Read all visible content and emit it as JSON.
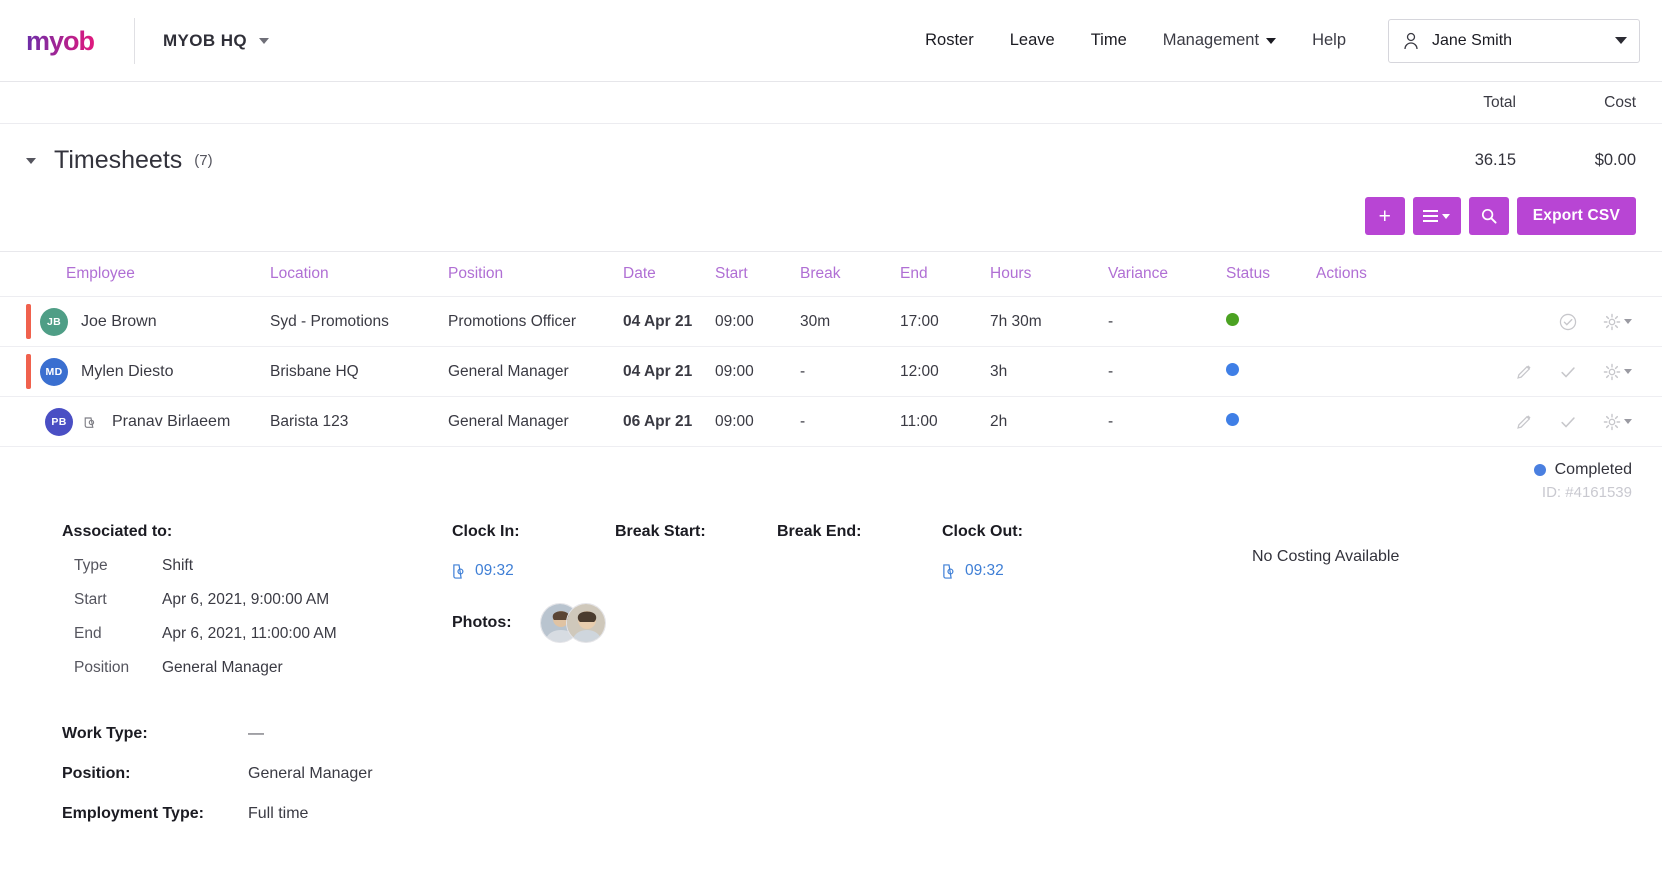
{
  "brand": {
    "logo_text": "myob",
    "logo_gradient_from": "#6c2ea8",
    "logo_gradient_to": "#e0197d"
  },
  "header": {
    "org_name": "MYOB HQ",
    "nav": [
      {
        "label": "Roster",
        "has_caret": false
      },
      {
        "label": "Leave",
        "has_caret": false
      },
      {
        "label": "Time",
        "has_caret": false
      },
      {
        "label": "Management",
        "has_caret": true
      },
      {
        "label": "Help",
        "has_caret": false
      }
    ],
    "user": {
      "name": "Jane Smith"
    }
  },
  "totals_header": {
    "total_label": "Total",
    "cost_label": "Cost"
  },
  "timesheets": {
    "title": "Timesheets",
    "count": "(7)",
    "total_value": "36.15",
    "cost_value": "$0.00"
  },
  "toolbar": {
    "add_label": "+",
    "menu_label": "menu",
    "search_label": "search",
    "export_label": "Export CSV",
    "accent": "#b845d4"
  },
  "table": {
    "columns": [
      "Employee",
      "Location",
      "Position",
      "Date",
      "Start",
      "Break",
      "End",
      "Hours",
      "Variance",
      "Status",
      "Actions"
    ],
    "rows": [
      {
        "initials": "JB",
        "avatar_color": "#4f9e86",
        "name": "Joe Brown",
        "has_photo_icon": false,
        "location": "Syd - Promotions",
        "position": "Promotions Officer",
        "date": "04 Apr 21",
        "start": "09:00",
        "break": "30m",
        "end": "17:00",
        "hours": "7h 30m",
        "variance": "-",
        "status_color": "#4ba222",
        "actions": [
          "check-circle-icon",
          "gear-icon"
        ]
      },
      {
        "initials": "MD",
        "avatar_color": "#3a6fd0",
        "name": "Mylen Diesto",
        "has_photo_icon": false,
        "location": "Brisbane HQ",
        "position": "General Manager",
        "date": "04 Apr 21",
        "start": "09:00",
        "break": "-",
        "end": "12:00",
        "hours": "3h",
        "variance": "-",
        "status_color": "#3f7fe6",
        "actions": [
          "pencil-icon",
          "check-icon",
          "gear-icon"
        ]
      },
      {
        "initials": "PB",
        "avatar_color": "#4a4fc4",
        "name": "Pranav Birlaeem",
        "has_photo_icon": true,
        "location": "Barista 123",
        "position": "General Manager",
        "date": "06 Apr 21",
        "start": "09:00",
        "break": "-",
        "end": "11:00",
        "hours": "2h",
        "variance": "-",
        "status_color": "#3f7fe6",
        "actions": [
          "pencil-icon",
          "check-icon",
          "gear-icon"
        ]
      }
    ]
  },
  "detail": {
    "status_label": "Completed",
    "status_color": "#4a7fe0",
    "record_id": "ID: #4161539",
    "associated": {
      "heading": "Associated to:",
      "rows": [
        {
          "key": "Type",
          "value": "Shift"
        },
        {
          "key": "Start",
          "value": "Apr 6, 2021, 9:00:00 AM"
        },
        {
          "key": "End",
          "value": "Apr 6, 2021, 11:00:00 AM"
        },
        {
          "key": "Position",
          "value": "General Manager"
        }
      ]
    },
    "clock_in": {
      "label": "Clock In:",
      "time": "09:32"
    },
    "break_start": {
      "label": "Break Start:",
      "time": ""
    },
    "break_end": {
      "label": "Break End:",
      "time": ""
    },
    "clock_out": {
      "label": "Clock Out:",
      "time": "09:32"
    },
    "photos_label": "Photos:",
    "costing_text": "No Costing Available",
    "bottom_rows": [
      {
        "key": "Work Type:",
        "value": "—"
      },
      {
        "key": "Position:",
        "value": "General Manager"
      },
      {
        "key": "Employment Type:",
        "value": "Full time"
      }
    ]
  }
}
